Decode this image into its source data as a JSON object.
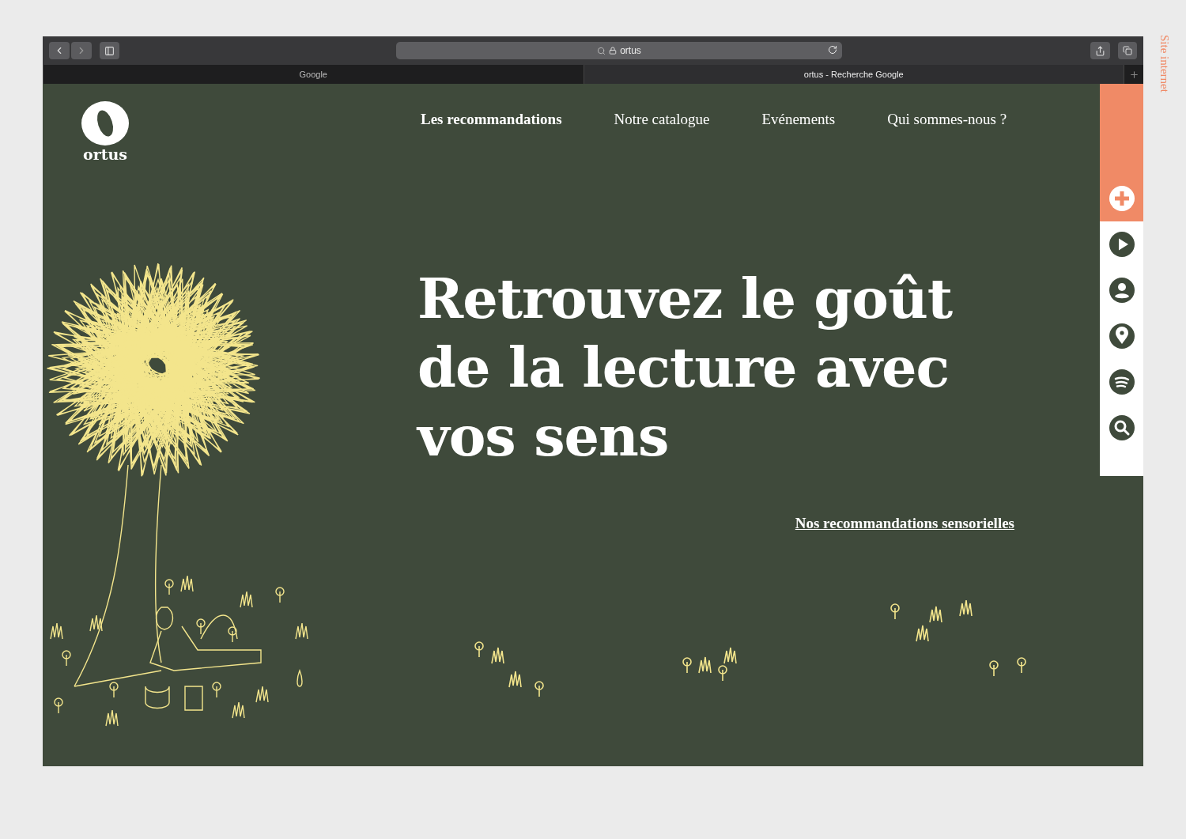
{
  "side_label": "Site internet",
  "browser": {
    "address": "ortus",
    "tabs": [
      {
        "label": "Google",
        "selected": false
      },
      {
        "label": "ortus - Recherche Google",
        "selected": true
      }
    ]
  },
  "site": {
    "logo_text": "ortus",
    "nav": [
      {
        "label": "Les recommandations",
        "selected": true
      },
      {
        "label": "Notre catalogue",
        "selected": false
      },
      {
        "label": "Evénements",
        "selected": false
      },
      {
        "label": "Qui sommes-nous ?",
        "selected": false
      }
    ],
    "headline": "Retrouvez le goût de la lecture avec vos sens",
    "link": "Nos recommandations sensorielles",
    "sidebar": [
      {
        "kind": "plus",
        "selected": true
      },
      {
        "kind": "play",
        "selected": false
      },
      {
        "kind": "user",
        "selected": false
      },
      {
        "kind": "pin",
        "selected": false
      },
      {
        "kind": "waves",
        "selected": false
      },
      {
        "kind": "search",
        "selected": false
      }
    ]
  }
}
